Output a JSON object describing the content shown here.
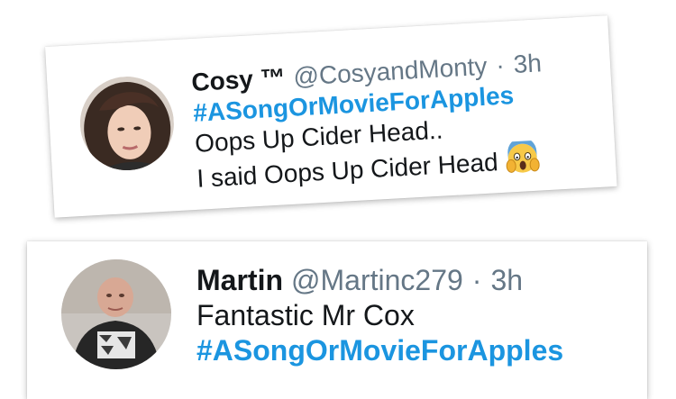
{
  "tweets": [
    {
      "display_name": "Cosy ™",
      "handle": "@CosyandMonty",
      "separator": "·",
      "timestamp": "3h",
      "hashtag": "#ASongOrMovieForApples",
      "text_line_1": "Oops Up Cider Head..",
      "text_line_2": "I said Oops Up Cider Head",
      "emoji_icon": "face-screaming-in-fear-emoji"
    },
    {
      "display_name": "Martin",
      "handle": "@Martinc279",
      "separator": "·",
      "timestamp": "3h",
      "text_line_1": "Fantastic Mr Cox",
      "hashtag": "#ASongOrMovieForApples"
    }
  ],
  "colors": {
    "hashtag": "#1b95e0",
    "handle": "#657786",
    "text": "#14171a"
  }
}
